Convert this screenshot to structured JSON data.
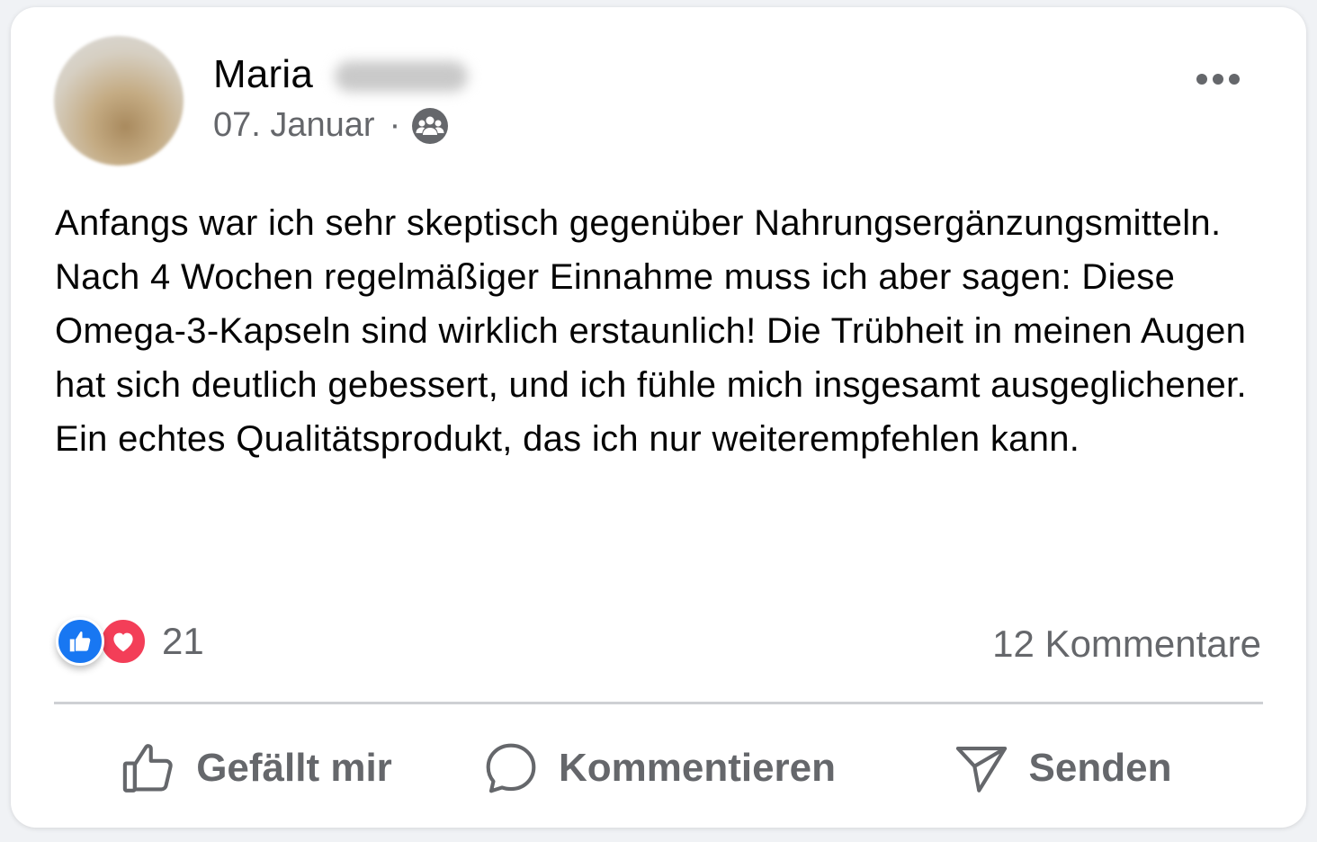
{
  "post": {
    "author_name": "Maria",
    "date": "07. Januar",
    "separator": "·",
    "audience_icon": "friends-group-icon",
    "text": "Anfangs war ich sehr skeptisch gegenüber Nahrungsergänzungsmitteln. Nach 4 Wochen regelmäßiger Einnahme muss ich aber sagen: Diese Omega-3-Kapseln sind wirklich erstaunlich! Die Trübheit in meinen Augen hat sich deutlich gebessert, und ich fühle mich insgesamt ausgeglichener. Ein echtes Qualitätsprodukt, das ich nur weiterempfehlen kann."
  },
  "stats": {
    "reaction_icons": [
      "like-icon",
      "love-icon"
    ],
    "reaction_count": "21",
    "comments_label": "12 Kommentare"
  },
  "actions": {
    "like_label": "Gefällt mir",
    "comment_label": "Kommentieren",
    "send_label": "Senden"
  },
  "colors": {
    "like_blue": "#1877f2",
    "love_red": "#f33e58",
    "secondary_text": "#65676b",
    "primary_text": "#050505"
  }
}
